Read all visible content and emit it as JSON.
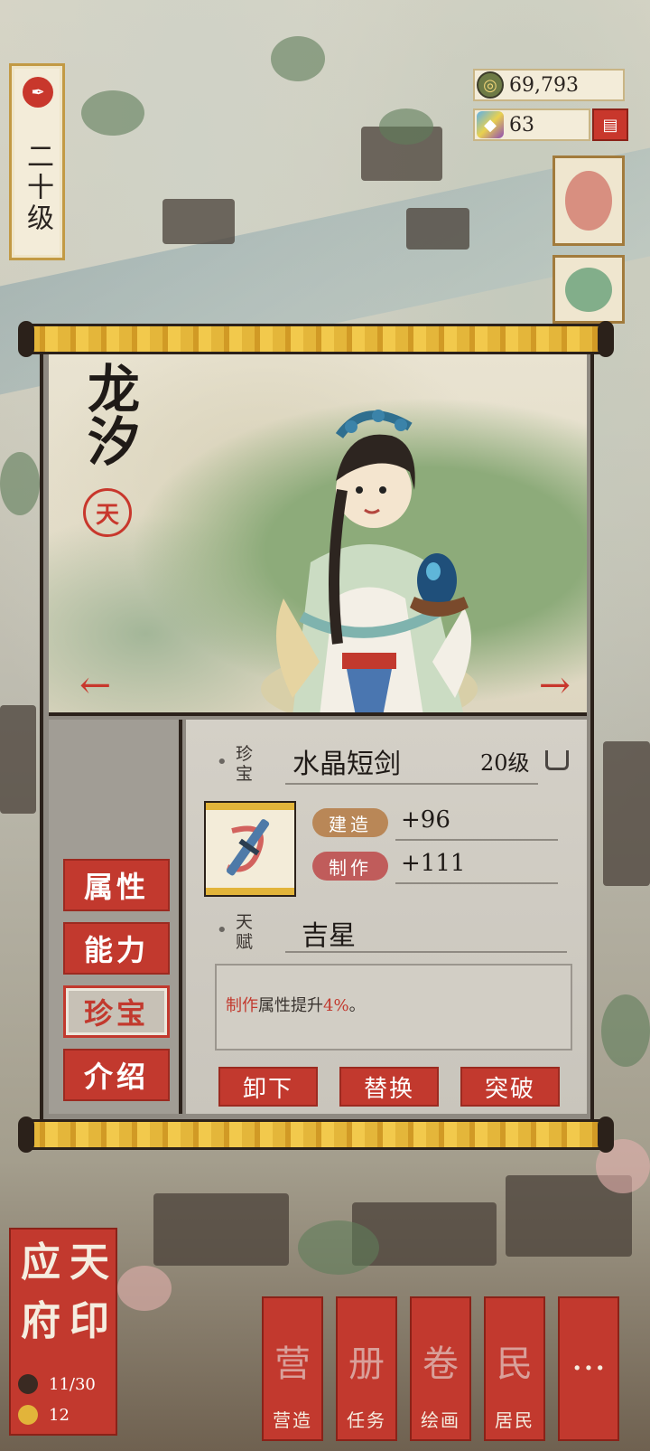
{
  "level_tag": {
    "text": "二十级",
    "seal_icon": "quill-icon"
  },
  "currency": {
    "coins": "69,793",
    "gems": "63",
    "coin_icon": "coin-icon",
    "gem_icon": "gem-icon",
    "shop_icon": "shop-icon"
  },
  "character": {
    "name": "龙汐",
    "seal_text": "天",
    "prev_arrow": "←",
    "next_arrow": "→"
  },
  "tabs": [
    {
      "label": "属性",
      "active": false
    },
    {
      "label": "能力",
      "active": false
    },
    {
      "label": "珍宝",
      "active": true
    },
    {
      "label": "介绍",
      "active": false
    }
  ],
  "treasure": {
    "section_label_1": "珍",
    "section_label_2": "宝",
    "name": "水晶短剑",
    "level": "20级",
    "stats": [
      {
        "tag": "建造",
        "value": "+96"
      },
      {
        "tag": "制作",
        "value": "+111"
      }
    ]
  },
  "talent": {
    "section_label_1": "天",
    "section_label_2": "赋",
    "name": "吉星",
    "desc_highlight": "制作",
    "desc_mid": "属性提升",
    "desc_percent": "4%",
    "desc_end": "。"
  },
  "actions": {
    "unequip": "卸下",
    "replace": "替换",
    "breakthrough": "突破"
  },
  "city": {
    "chars": [
      "应",
      "天",
      "府",
      "印"
    ],
    "population": "11/30",
    "second_stat": "12"
  },
  "bottom_nav": [
    {
      "label": "营造",
      "glyph": "营"
    },
    {
      "label": "任务",
      "glyph": "册"
    },
    {
      "label": "绘画",
      "glyph": "卷"
    },
    {
      "label": "居民",
      "glyph": "民"
    },
    {
      "label": "",
      "glyph": "···"
    }
  ],
  "colors": {
    "accent_red": "#c2392e",
    "gold": "#e2b43a",
    "paper": "#f3ecd9"
  }
}
